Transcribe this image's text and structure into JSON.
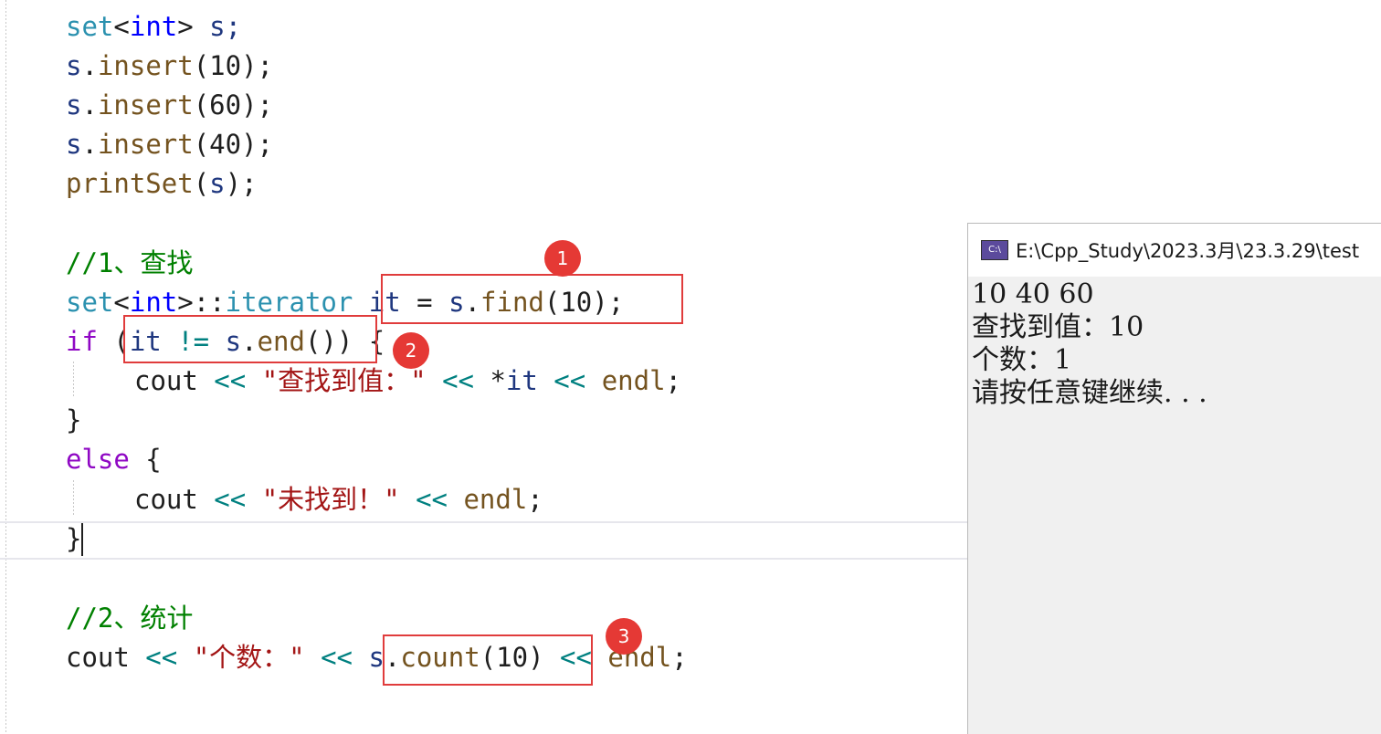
{
  "editor": {
    "lines": [
      {
        "t1": "set",
        "t2": "<",
        "t3": "int",
        "t4": ">",
        "t5": " s;"
      },
      {
        "obj": "s",
        "dot": ".",
        "fn": "insert",
        "args": "(10);"
      },
      {
        "obj": "s",
        "dot": ".",
        "fn": "insert",
        "args": "(60);"
      },
      {
        "obj": "s",
        "dot": ".",
        "fn": "insert",
        "args": "(40);"
      },
      {
        "fn": "printSet",
        "args": "(",
        "var": "s",
        "end": ");"
      }
    ],
    "comment_find": "//1、查找",
    "iter_line": {
      "set": "set",
      "lt": "<",
      "int": "int",
      "gt": ">",
      "scope": "::",
      "iterator": "iterator",
      "rest_var": "it",
      "eq": " = ",
      "obj": "s",
      "dot": ".",
      "fn": "find",
      "args": "(10);"
    },
    "if_line": {
      "kw": "if",
      "open": " (",
      "var": "it",
      "neq": " != ",
      "obj": "s",
      "dot": ".",
      "fn": "end",
      "args": "())",
      "brace": " {"
    },
    "cout_found": {
      "cout": "cout",
      "op1": " << ",
      "str": "\"查找到值：\"",
      "op2": " << ",
      "deref": "*",
      "var": "it",
      "op3": " << ",
      "endl": "endl",
      "semi": ";"
    },
    "close_brace_1": "}",
    "else_line": {
      "kw": "else",
      "brace": " {"
    },
    "cout_notfound": {
      "cout": "cout",
      "op1": " << ",
      "str": "\"未找到！\"",
      "op2": " << ",
      "endl": "endl",
      "semi": ";"
    },
    "close_brace_2": "}",
    "comment_count": "//2、统计",
    "cout_count": {
      "cout": "cout",
      "op1": " << ",
      "str": "\"个数：\"",
      "op2": " << ",
      "obj": "s",
      "dot": ".",
      "fn": "count",
      "args": "(10)",
      "op3": " << ",
      "endl": "endl",
      "semi": ";"
    }
  },
  "annotations": [
    "1",
    "2",
    "3"
  ],
  "console": {
    "title": "E:\\Cpp_Study\\2023.3月\\23.3.29\\test",
    "icon": "C:\\",
    "output": [
      "10 40 60",
      "查找到值：10",
      "个数：1",
      "请按任意键继续. . ."
    ]
  }
}
